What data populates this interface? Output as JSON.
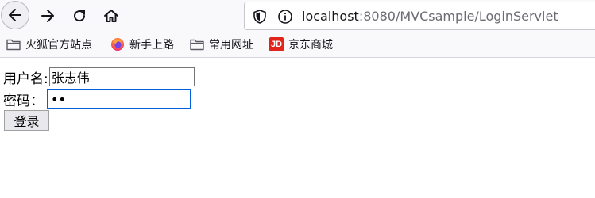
{
  "browser": {
    "url_host": "localhost",
    "url_rest": ":8080/MVCsample/LoginServlet",
    "icons": {
      "back": "back-arrow-icon",
      "forward": "forward-arrow-icon",
      "reload": "reload-icon",
      "home": "home-icon",
      "shield": "tracking-protection-shield-icon",
      "info": "site-info-icon"
    }
  },
  "bookmarks": [
    {
      "label": "火狐官方站点",
      "icon": "folder-icon"
    },
    {
      "label": "新手上路",
      "icon": "firefox-icon"
    },
    {
      "label": "常用网址",
      "icon": "folder-icon"
    },
    {
      "label": "京东商城",
      "icon": "jd-logo-icon",
      "logo_text": "JD"
    }
  ],
  "form": {
    "username_label": "用户名:",
    "username_value": "张志伟",
    "password_label": "密码：",
    "password_value": "ab",
    "submit_label": "登录"
  },
  "colors": {
    "focus_border": "#0060df",
    "jd_red": "#e1251b",
    "chrome_bg": "#f9f9fb"
  }
}
